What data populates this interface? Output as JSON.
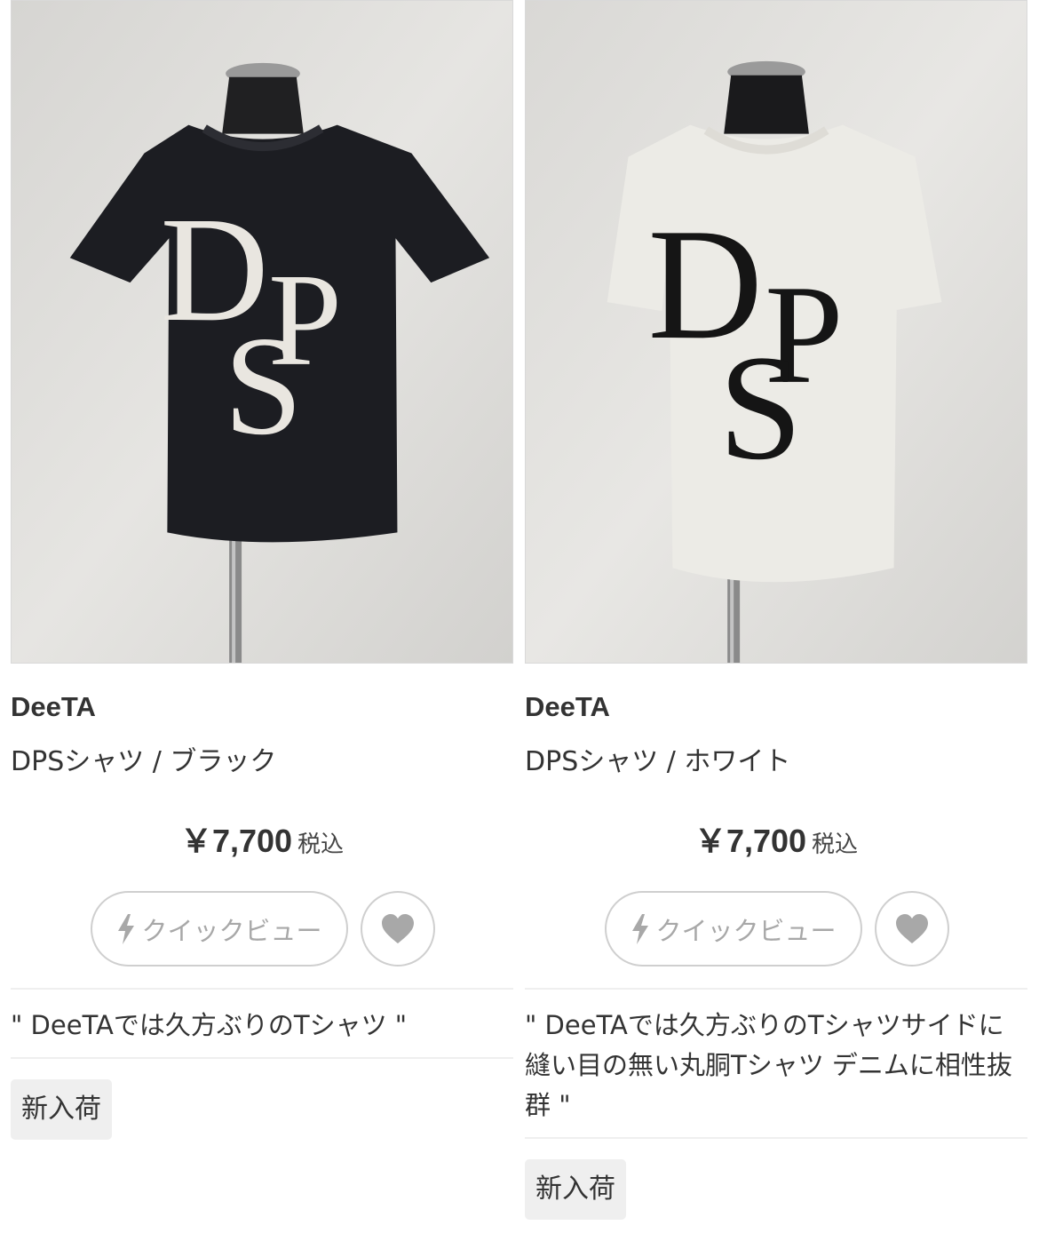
{
  "products": [
    {
      "brand": "DeeTA",
      "name": "DPSシャツ / ブラック",
      "price": "￥7,700",
      "tax_label": "税込",
      "quickview_label": "クイックビュー",
      "comment": "\" DeeTAでは久方ぶりのTシャツ \"",
      "badge": "新入荷",
      "shirt_color": "#1c1d22",
      "print_color": "#e9e6e0",
      "print_text": "DPS"
    },
    {
      "brand": "DeeTA",
      "name": "DPSシャツ / ホワイト",
      "price": "￥7,700",
      "tax_label": "税込",
      "quickview_label": "クイックビュー",
      "comment": "\" DeeTAでは久方ぶりのTシャツサイドに縫い目の無い丸胴Tシャツ デニムに相性抜群 \"",
      "badge": "新入荷",
      "shirt_color": "#ecebe6",
      "print_color": "#151515",
      "print_text": "DPS"
    }
  ],
  "icons": {
    "quickview": "lightning-icon",
    "favorite": "heart-icon"
  },
  "colors": {
    "text": "#333333",
    "button_border": "#cfcfcf",
    "button_text": "#a8a8a8",
    "badge_bg": "#efefef"
  }
}
